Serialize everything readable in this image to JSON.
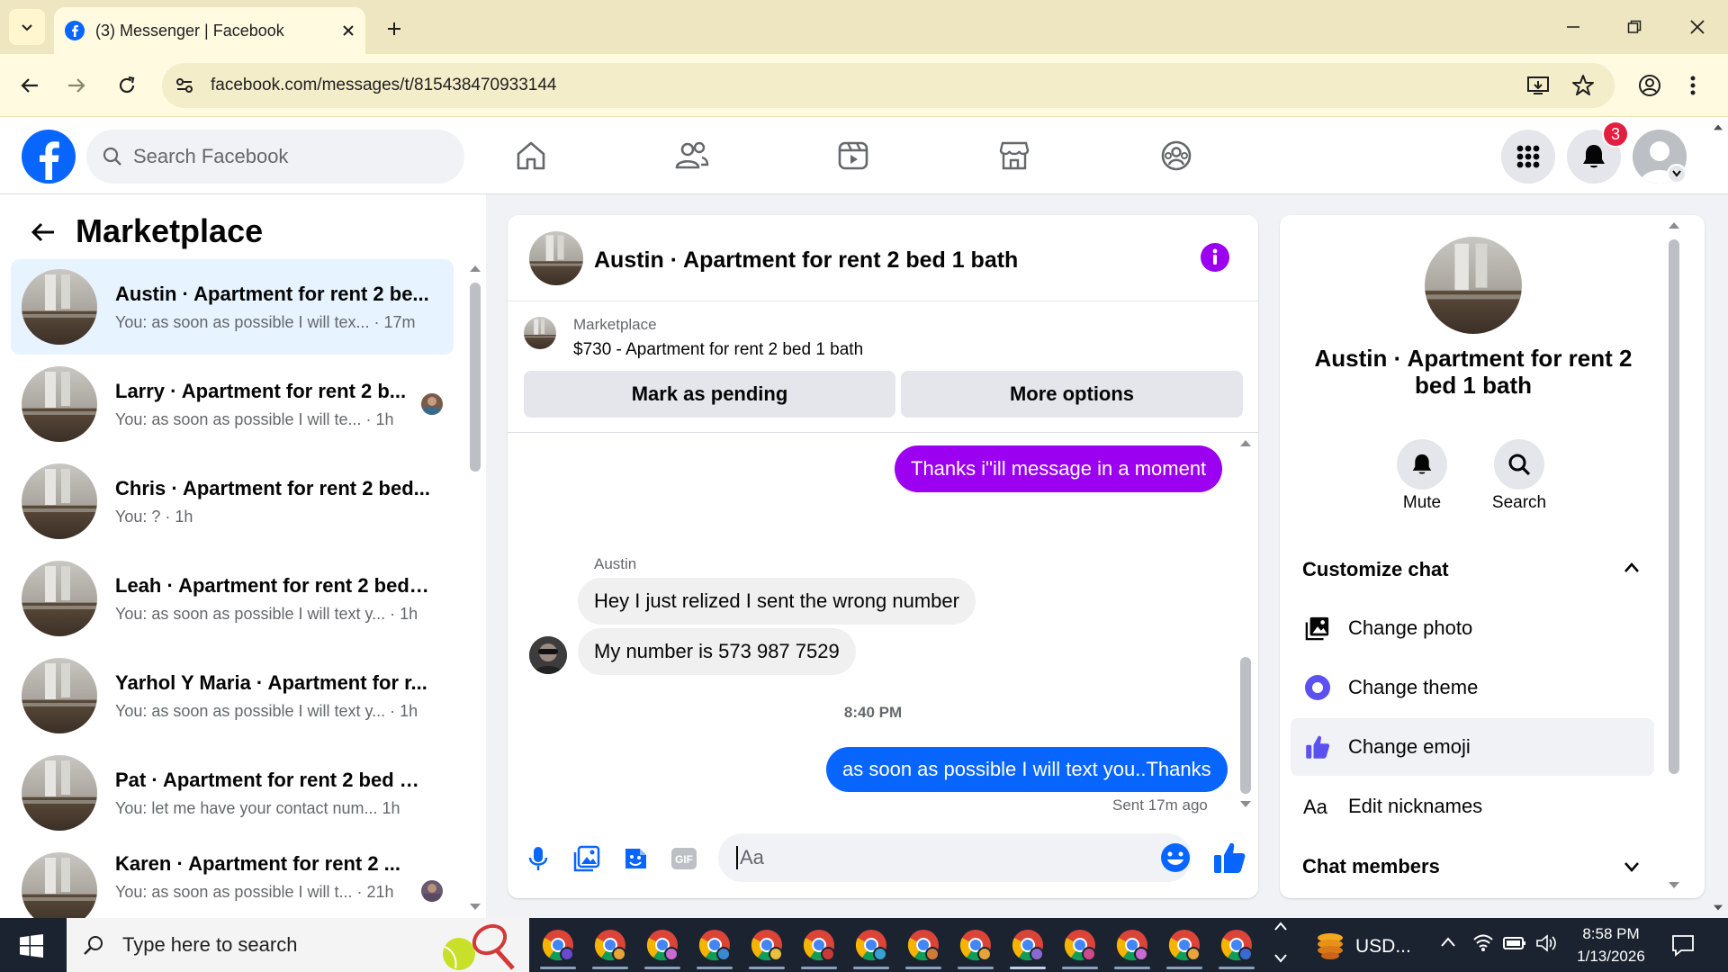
{
  "browser": {
    "tab_title": "(3) Messenger | Facebook",
    "url": "facebook.com/messages/t/815438470933144"
  },
  "fb_header": {
    "search_placeholder": "Search Facebook",
    "notification_count": "3"
  },
  "left_panel": {
    "title": "Marketplace",
    "conversations": [
      {
        "name": "Austin · Apartment for rent 2 be...",
        "preview": "You: as soon as possible I will tex... · 17m",
        "active": true
      },
      {
        "name": "Larry · Apartment for rent 2 b...",
        "preview": "You: as soon as possible I will te... · 1h"
      },
      {
        "name": "Chris · Apartment for rent 2 bed...",
        "preview": "You: ? · 1h"
      },
      {
        "name": "Leah · Apartment for rent 2 bed ...",
        "preview": "You: as soon as possible I will text y... · 1h"
      },
      {
        "name": "Yarhol Y Maria · Apartment for r...",
        "preview": "You: as soon as possible I will text y... · 1h"
      },
      {
        "name": "Pat · Apartment for rent 2 bed 1 ...",
        "preview": "You: let me have your contact num...   1h"
      },
      {
        "name": "Karen · Apartment for rent 2 ...",
        "preview": "You: as soon as possible I will t... · 21h"
      }
    ]
  },
  "chat": {
    "title": "Austin · Apartment for rent 2 bed 1 bath",
    "marketplace_label": "Marketplace",
    "listing": "$730 - Apartment for rent 2 bed 1 bath",
    "mark_pending": "Mark as pending",
    "more_options": "More options",
    "messages": {
      "out1": "Thanks i\"ill message in a moment",
      "sender": "Austin",
      "in1": "Hey I just relized I sent the wrong number",
      "in2": "My number is 573 987 7529",
      "timestamp": "8:40 PM",
      "out2": "as soon as possible I will text you..Thanks",
      "status": "Sent 17m ago"
    },
    "composer_placeholder": "Aa"
  },
  "right_panel": {
    "name": "Austin · Apartment for rent 2 bed 1 bath",
    "mute": "Mute",
    "search": "Search",
    "customize": "Customize chat",
    "items": [
      "Change photo",
      "Change theme",
      "Change emoji",
      "Edit nicknames"
    ],
    "members": "Chat members"
  },
  "taskbar": {
    "search_text": "Type here to search",
    "tray_label": "USD...",
    "time": "8:58 PM",
    "date": "1/13/2026"
  },
  "colors": {
    "fb_blue": "#0866ff",
    "messenger_purple": "#9b00f0",
    "notif_red": "#e41e3f"
  }
}
